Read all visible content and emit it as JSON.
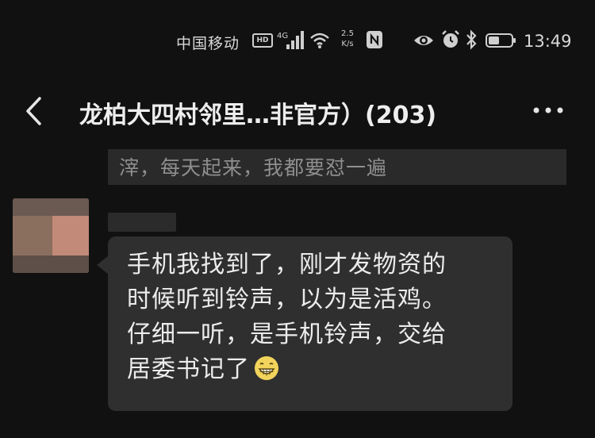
{
  "status_bar": {
    "carrier": "中国移动",
    "hd_badge": "HD",
    "net_speed_value": "2.5",
    "net_speed_unit": "K/s",
    "time": "13:49"
  },
  "header": {
    "title": "龙柏大四村邻里…非官方）(203)"
  },
  "messages": {
    "previous_fragment": "滓，每天起来，我都要怼一遍",
    "incoming": {
      "lines": [
        "手机我找到了，刚才发物资的",
        "时候听到铃声，以为是活鸡。",
        "仔细一听，是手机铃声，交给",
        "居委书记了"
      ],
      "emoji": "grinning-face-emoji"
    }
  },
  "colors": {
    "background": "#111111",
    "bubble": "#2f2f2f",
    "text": "#ececec",
    "muted_text": "#8f8f8f"
  }
}
